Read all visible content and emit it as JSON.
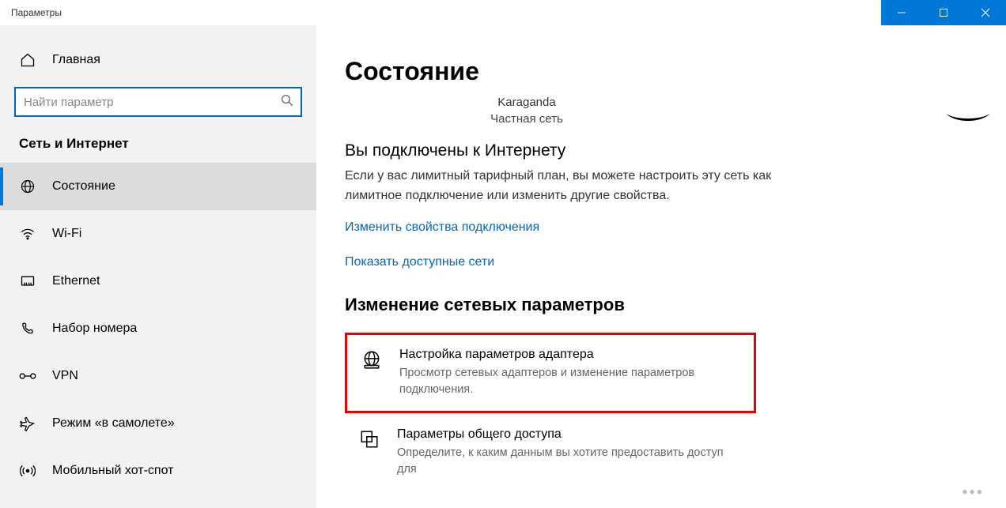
{
  "window": {
    "title": "Параметры"
  },
  "sidebar": {
    "home": "Главная",
    "search_placeholder": "Найти параметр",
    "category": "Сеть и Интернет",
    "items": [
      {
        "label": "Состояние"
      },
      {
        "label": "Wi-Fi"
      },
      {
        "label": "Ethernet"
      },
      {
        "label": "Набор номера"
      },
      {
        "label": "VPN"
      },
      {
        "label": "Режим «в самолете»"
      },
      {
        "label": "Мобильный хот-спот"
      }
    ]
  },
  "main": {
    "title": "Состояние",
    "network_name": "Karaganda",
    "network_type": "Частная сеть",
    "connected_heading": "Вы подключены к Интернету",
    "connected_blurb": "Если у вас лимитный тарифный план, вы можете настроить эту сеть как лимитное подключение или изменить другие свойства.",
    "link_change": "Изменить свойства подключения",
    "link_show": "Показать доступные сети",
    "change_section": "Изменение сетевых параметров",
    "opt1_title": "Настройка параметров адаптера",
    "opt1_desc": "Просмотр сетевых адаптеров и изменение параметров подключения.",
    "opt2_title": "Параметры общего доступа",
    "opt2_desc": "Определите, к каким данным вы хотите предоставить доступ для"
  }
}
